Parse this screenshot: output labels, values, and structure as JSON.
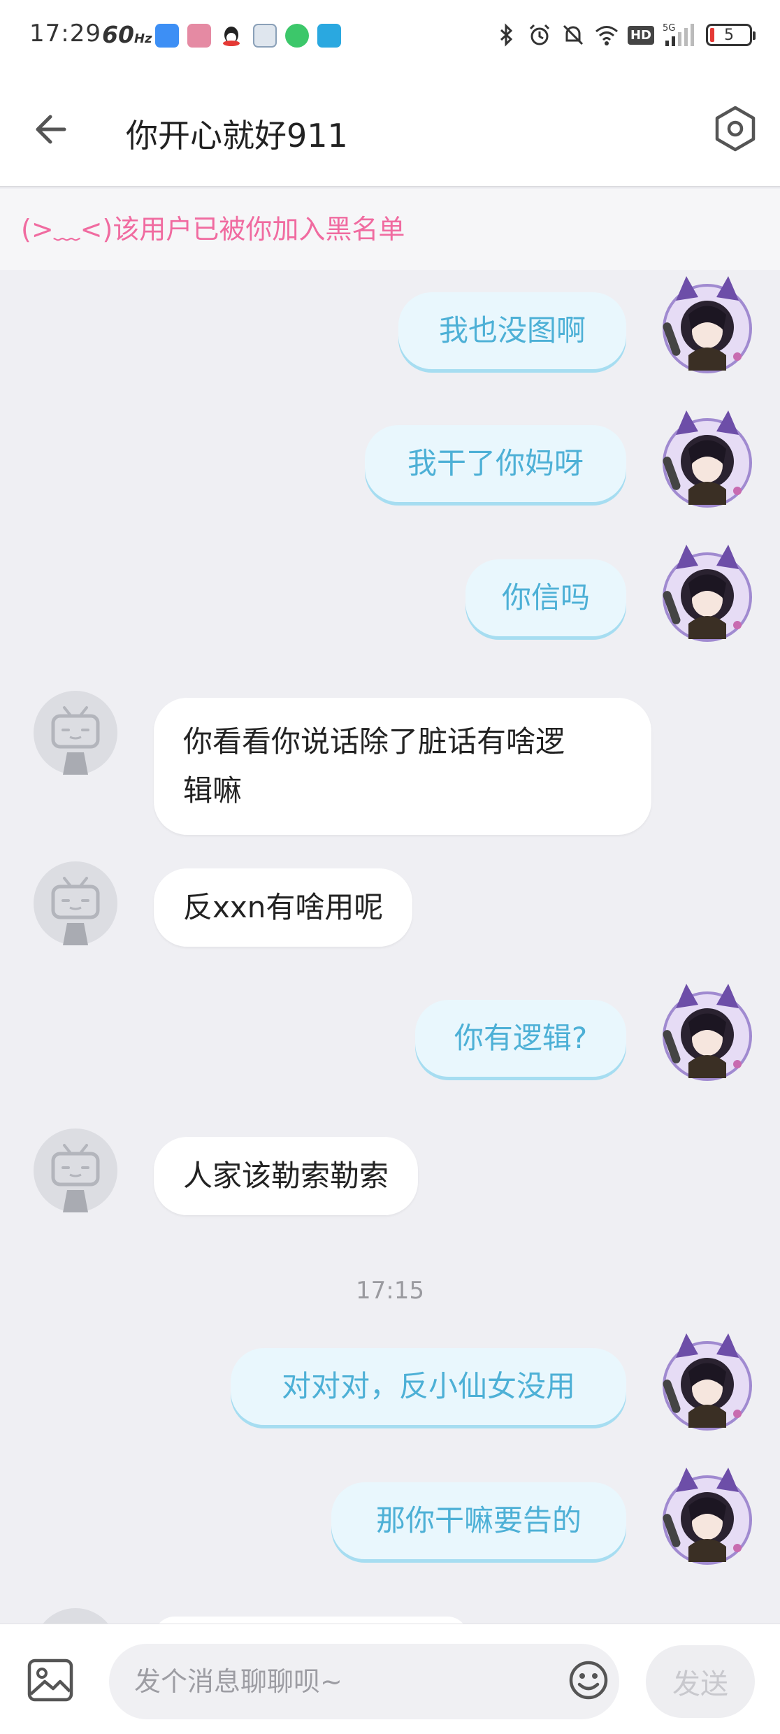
{
  "status_bar": {
    "time": "17:29",
    "refresh_rate": "60",
    "refresh_unit": "Hz",
    "battery": "5",
    "network": "5G"
  },
  "header": {
    "title": "你开心就好911",
    "back_icon": "arrow-left-icon",
    "settings_icon": "hexagon-gear-icon"
  },
  "notice": {
    "text": "(>﹏<)该用户已被你加入黑名单"
  },
  "messages": [
    {
      "sender": "me",
      "text": "我也没图啊"
    },
    {
      "sender": "me",
      "text": "我干了你妈呀"
    },
    {
      "sender": "me",
      "text": "你信吗"
    },
    {
      "sender": "other",
      "line1": "你看看你说话除了脏话有啥逻",
      "line2": "辑嘛"
    },
    {
      "sender": "other",
      "text": "反xxn有啥用呢"
    },
    {
      "sender": "me",
      "text": "你有逻辑?"
    },
    {
      "sender": "other",
      "text": "人家该勒索勒索"
    },
    {
      "sender": "me",
      "text": "对对对，反小仙女没用"
    },
    {
      "sender": "me",
      "text": "那你干嘛要告的"
    }
  ],
  "timestamp": "17:15",
  "composer": {
    "placeholder": "发个消息聊聊呗~",
    "send_label": "发送",
    "image_icon": "image-icon",
    "emoji_icon": "emoji-icon"
  },
  "colors": {
    "my_bubble_bg": "#e9f7fd",
    "my_bubble_text": "#4db0d6",
    "notice_text": "#f06ba0",
    "chat_bg": "#efeff3"
  }
}
